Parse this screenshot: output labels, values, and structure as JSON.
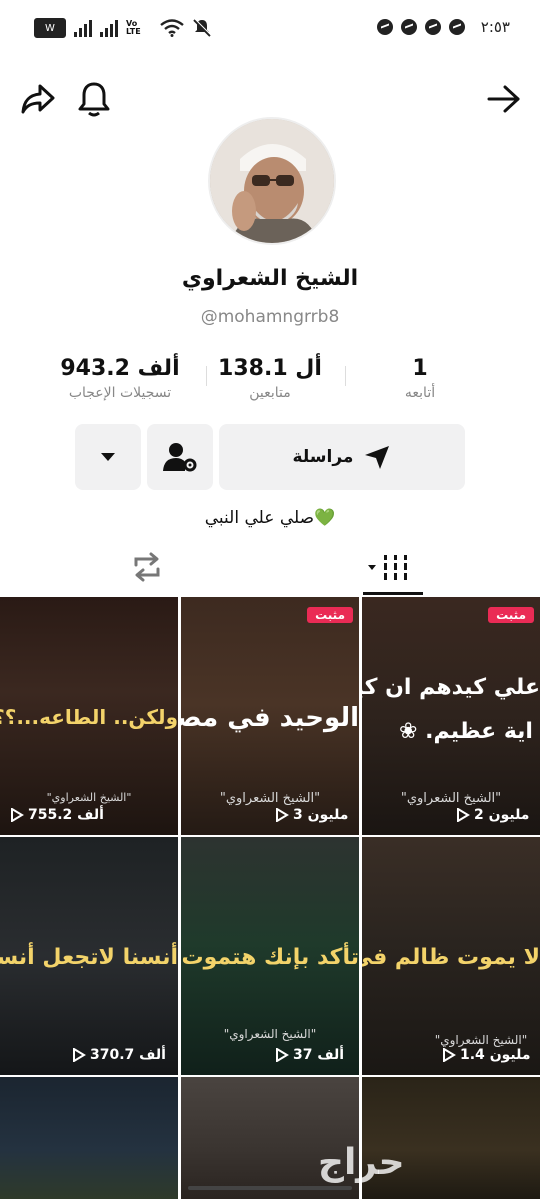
{
  "status_bar": {
    "time": "٢:٥٣",
    "carrier_badge": "W",
    "network": "Vo LTE",
    "icons": [
      "messenger-icon",
      "messenger-icon",
      "messenger-icon",
      "messenger-icon",
      "mute-icon",
      "wifi-icon",
      "signal-icon"
    ]
  },
  "header": {
    "icons": [
      "share-icon",
      "bell-icon",
      "back-arrow-icon"
    ]
  },
  "profile": {
    "display_name": "الشيخ الشعراوي",
    "username": "@mohamngrrb8",
    "bio": "صلي علي النبي💚"
  },
  "stats": {
    "likes": {
      "value": "943.2 ألف",
      "label": "تسجيلات الإعجاب"
    },
    "followers": {
      "value": "138.1 أل",
      "label": "متابعين"
    },
    "following": {
      "value": "1",
      "label": "أتابعه"
    }
  },
  "actions": {
    "message_label": "مراسلة"
  },
  "tabs": [
    "repost-tab",
    "videos-tab"
  ],
  "videos": [
    {
      "overlay": "ولكن.. الطاعه...؟؟",
      "source": "\"الشيخ الشعراوي\"",
      "views": "755.2 ألف",
      "pinned": false,
      "overlay_color": "#f3d36a"
    },
    {
      "overlay": "الوحيد في مصر",
      "source": "\"الشيخ الشعراوي\"",
      "views": "3 مليون",
      "pinned": true,
      "pinned_label": "مثبت",
      "overlay_color": "#ffffff"
    },
    {
      "overlay": "علي كيدهم ان كيـ",
      "overlay2": "اية عظيم. ❀",
      "source": "\"الشيخ الشعراوي\"",
      "views": "2 مليون",
      "pinned": true,
      "pinned_label": "مثبت",
      "overlay_color": "#ffffff"
    },
    {
      "overlay": "أنسنا لاتجعل أنسنا إلا",
      "source": "\"الشيخ الشعراوي\"",
      "views": "370.7 ألف",
      "pinned": false,
      "overlay_color": "#f3d36a"
    },
    {
      "overlay": "تأكد بإنك هتموت",
      "source": "\"الشيخ الشعراوي\"",
      "views": "37 ألف",
      "pinned": false,
      "overlay_color": "#f3d36a"
    },
    {
      "overlay": "لا يموت ظالم في الد",
      "source": "\"الشيخ الشعراوي\"",
      "views": "1.4 مليون",
      "pinned": false,
      "overlay_color": "#f3d36a"
    }
  ],
  "watermark": "حراج"
}
